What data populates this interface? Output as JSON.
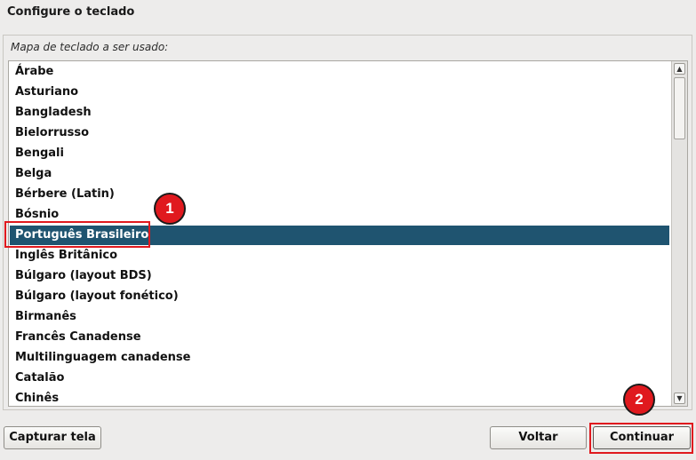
{
  "window": {
    "title": "Configure o teclado"
  },
  "panel": {
    "label": "Mapa de teclado a ser usado:"
  },
  "keymap_list": {
    "items": [
      "Árabe",
      "Asturiano",
      "Bangladesh",
      "Bielorrusso",
      "Bengali",
      "Belga",
      "Bérbere (Latin)",
      "Bósnio",
      "Português Brasileiro",
      "Inglês Britânico",
      "Búlgaro (layout BDS)",
      "Búlgaro (layout fonético)",
      "Birmanês",
      "Francês Canadense",
      "Multilinguagem canadense",
      "Catalão",
      "Chinês"
    ],
    "selected": "Português Brasileiro"
  },
  "scrollbar": {
    "up_icon": "▲",
    "down_icon": "▼"
  },
  "buttons": {
    "capture": "Capturar tela",
    "back": "Voltar",
    "continue": "Continuar"
  },
  "annotations": {
    "step1": "1",
    "step2": "2",
    "color": "#e0191e"
  }
}
